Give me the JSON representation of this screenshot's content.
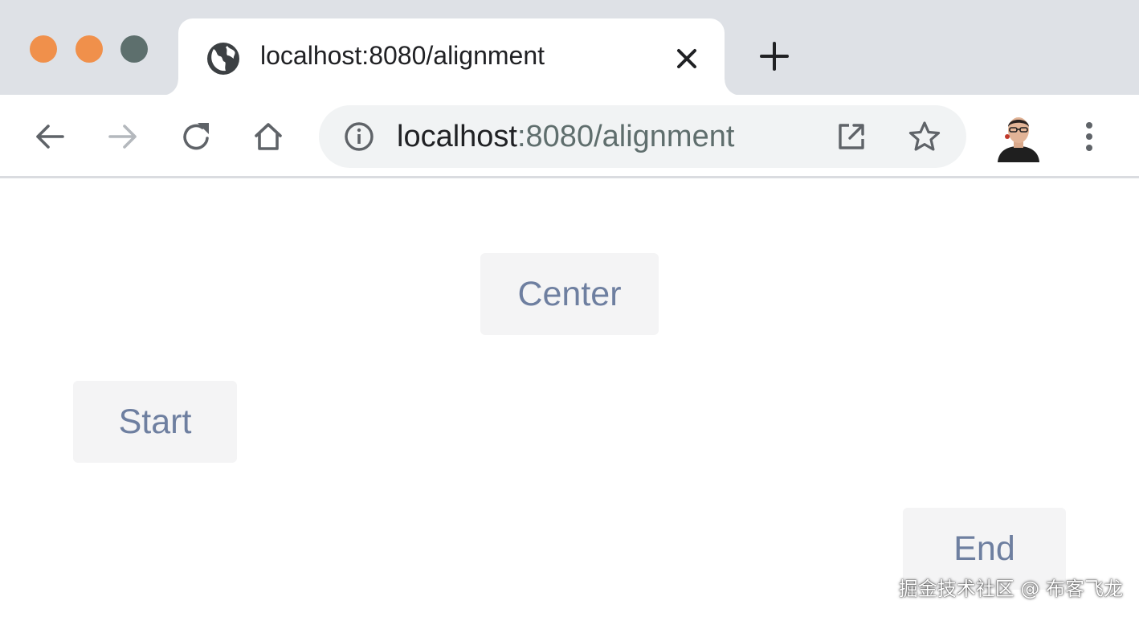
{
  "window": {
    "traffic_lights": [
      "close",
      "minimize",
      "zoom"
    ]
  },
  "tab": {
    "title": "localhost:8080/alignment",
    "favicon": "globe-icon",
    "close_icon": "close-icon"
  },
  "new_tab_icon": "plus-icon",
  "toolbar": {
    "back_icon": "arrow-left-icon",
    "forward_icon": "arrow-right-icon",
    "reload_icon": "reload-icon",
    "home_icon": "home-icon",
    "menu_icon": "kebab-menu-icon"
  },
  "omnibox": {
    "info_icon": "info-icon",
    "host": "localhost",
    "rest": ":8080/alignment",
    "open_icon": "open-external-icon",
    "star_icon": "star-icon"
  },
  "page": {
    "center_label": "Center",
    "start_label": "Start",
    "end_label": "End"
  },
  "watermark": "掘金技术社区 @ 布客飞龙",
  "colors": {
    "tabstrip_bg": "#dee1e6",
    "traffic_red": "#f0904b",
    "traffic_yellow": "#f0904b",
    "traffic_green": "#5d6f6d",
    "button_bg": "#f4f4f5",
    "button_text": "#6e7fa0",
    "url_path": "#5f6e6d"
  }
}
